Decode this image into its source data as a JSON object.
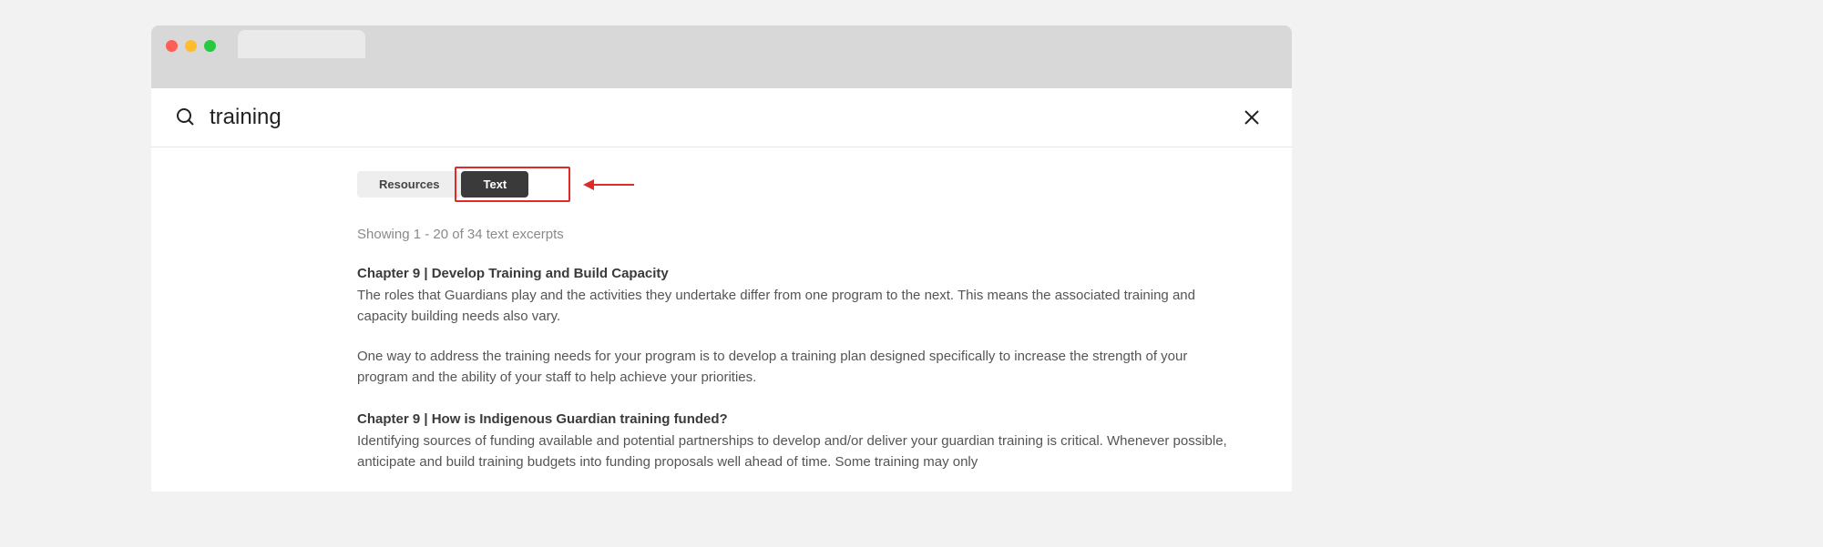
{
  "search": {
    "value": "training",
    "placeholder": ""
  },
  "tabs": {
    "resources": "Resources",
    "text": "Text"
  },
  "results_meta": "Showing 1 - 20 of 34 text excerpts",
  "results": [
    {
      "title": "Chapter 9 | Develop Training and Build Capacity",
      "p1": "The roles that Guardians play and the activities they undertake differ from one program to the next. This means the associated training and capacity building needs also vary.",
      "p2": "One way to address the training needs for your program is to develop a training plan designed specifically to increase the strength of your program and the ability of your staff to help achieve your priorities."
    },
    {
      "title": "Chapter 9 | How is Indigenous Guardian training funded?",
      "p1": "Identifying sources of funding available and potential partnerships to develop and/or deliver your guardian training is critical. Whenever possible, anticipate and build training budgets into funding proposals well ahead of time. Some training may only"
    }
  ]
}
